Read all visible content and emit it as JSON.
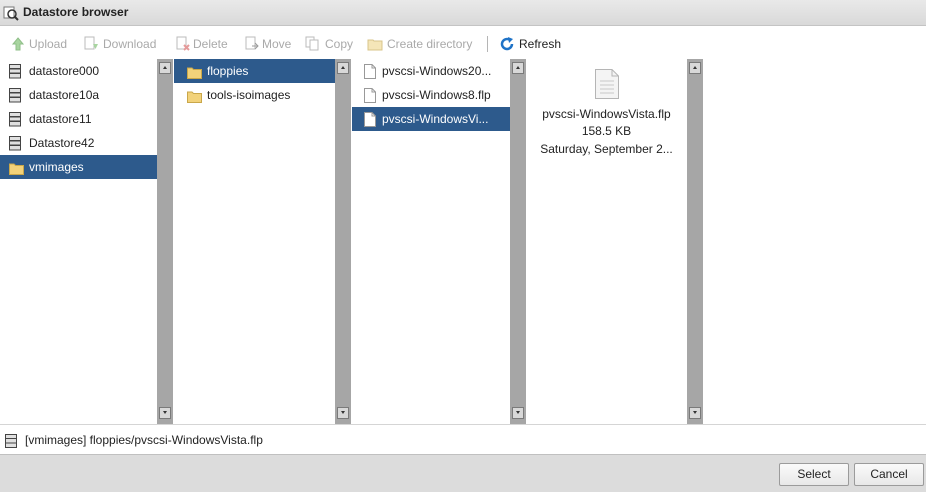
{
  "window": {
    "title": "Datastore browser"
  },
  "toolbar": {
    "upload": "Upload",
    "download": "Download",
    "delete": "Delete",
    "move": "Move",
    "copy": "Copy",
    "create_directory": "Create directory",
    "refresh": "Refresh"
  },
  "datastores": [
    {
      "label": "datastore000"
    },
    {
      "label": "datastore10a"
    },
    {
      "label": "datastore11"
    },
    {
      "label": "Datastore42"
    },
    {
      "label": "vmimages",
      "selected": true
    }
  ],
  "folders": [
    {
      "label": "floppies",
      "selected": true
    },
    {
      "label": "tools-isoimages"
    }
  ],
  "files": [
    {
      "label": "pvscsi-Windows20..."
    },
    {
      "label": "pvscsi-Windows8.flp"
    },
    {
      "label": "pvscsi-WindowsVi...",
      "selected": true
    }
  ],
  "preview": {
    "name": "pvscsi-WindowsVista.flp",
    "size": "158.5 KB",
    "date": "Saturday, September 2..."
  },
  "path": "[vmimages] floppies/pvscsi-WindowsVista.flp",
  "footer": {
    "select": "Select",
    "cancel": "Cancel"
  },
  "colors": {
    "selection": "#2d5a8c",
    "refresh": "#1f73c7",
    "folder": "#f2d27a"
  }
}
